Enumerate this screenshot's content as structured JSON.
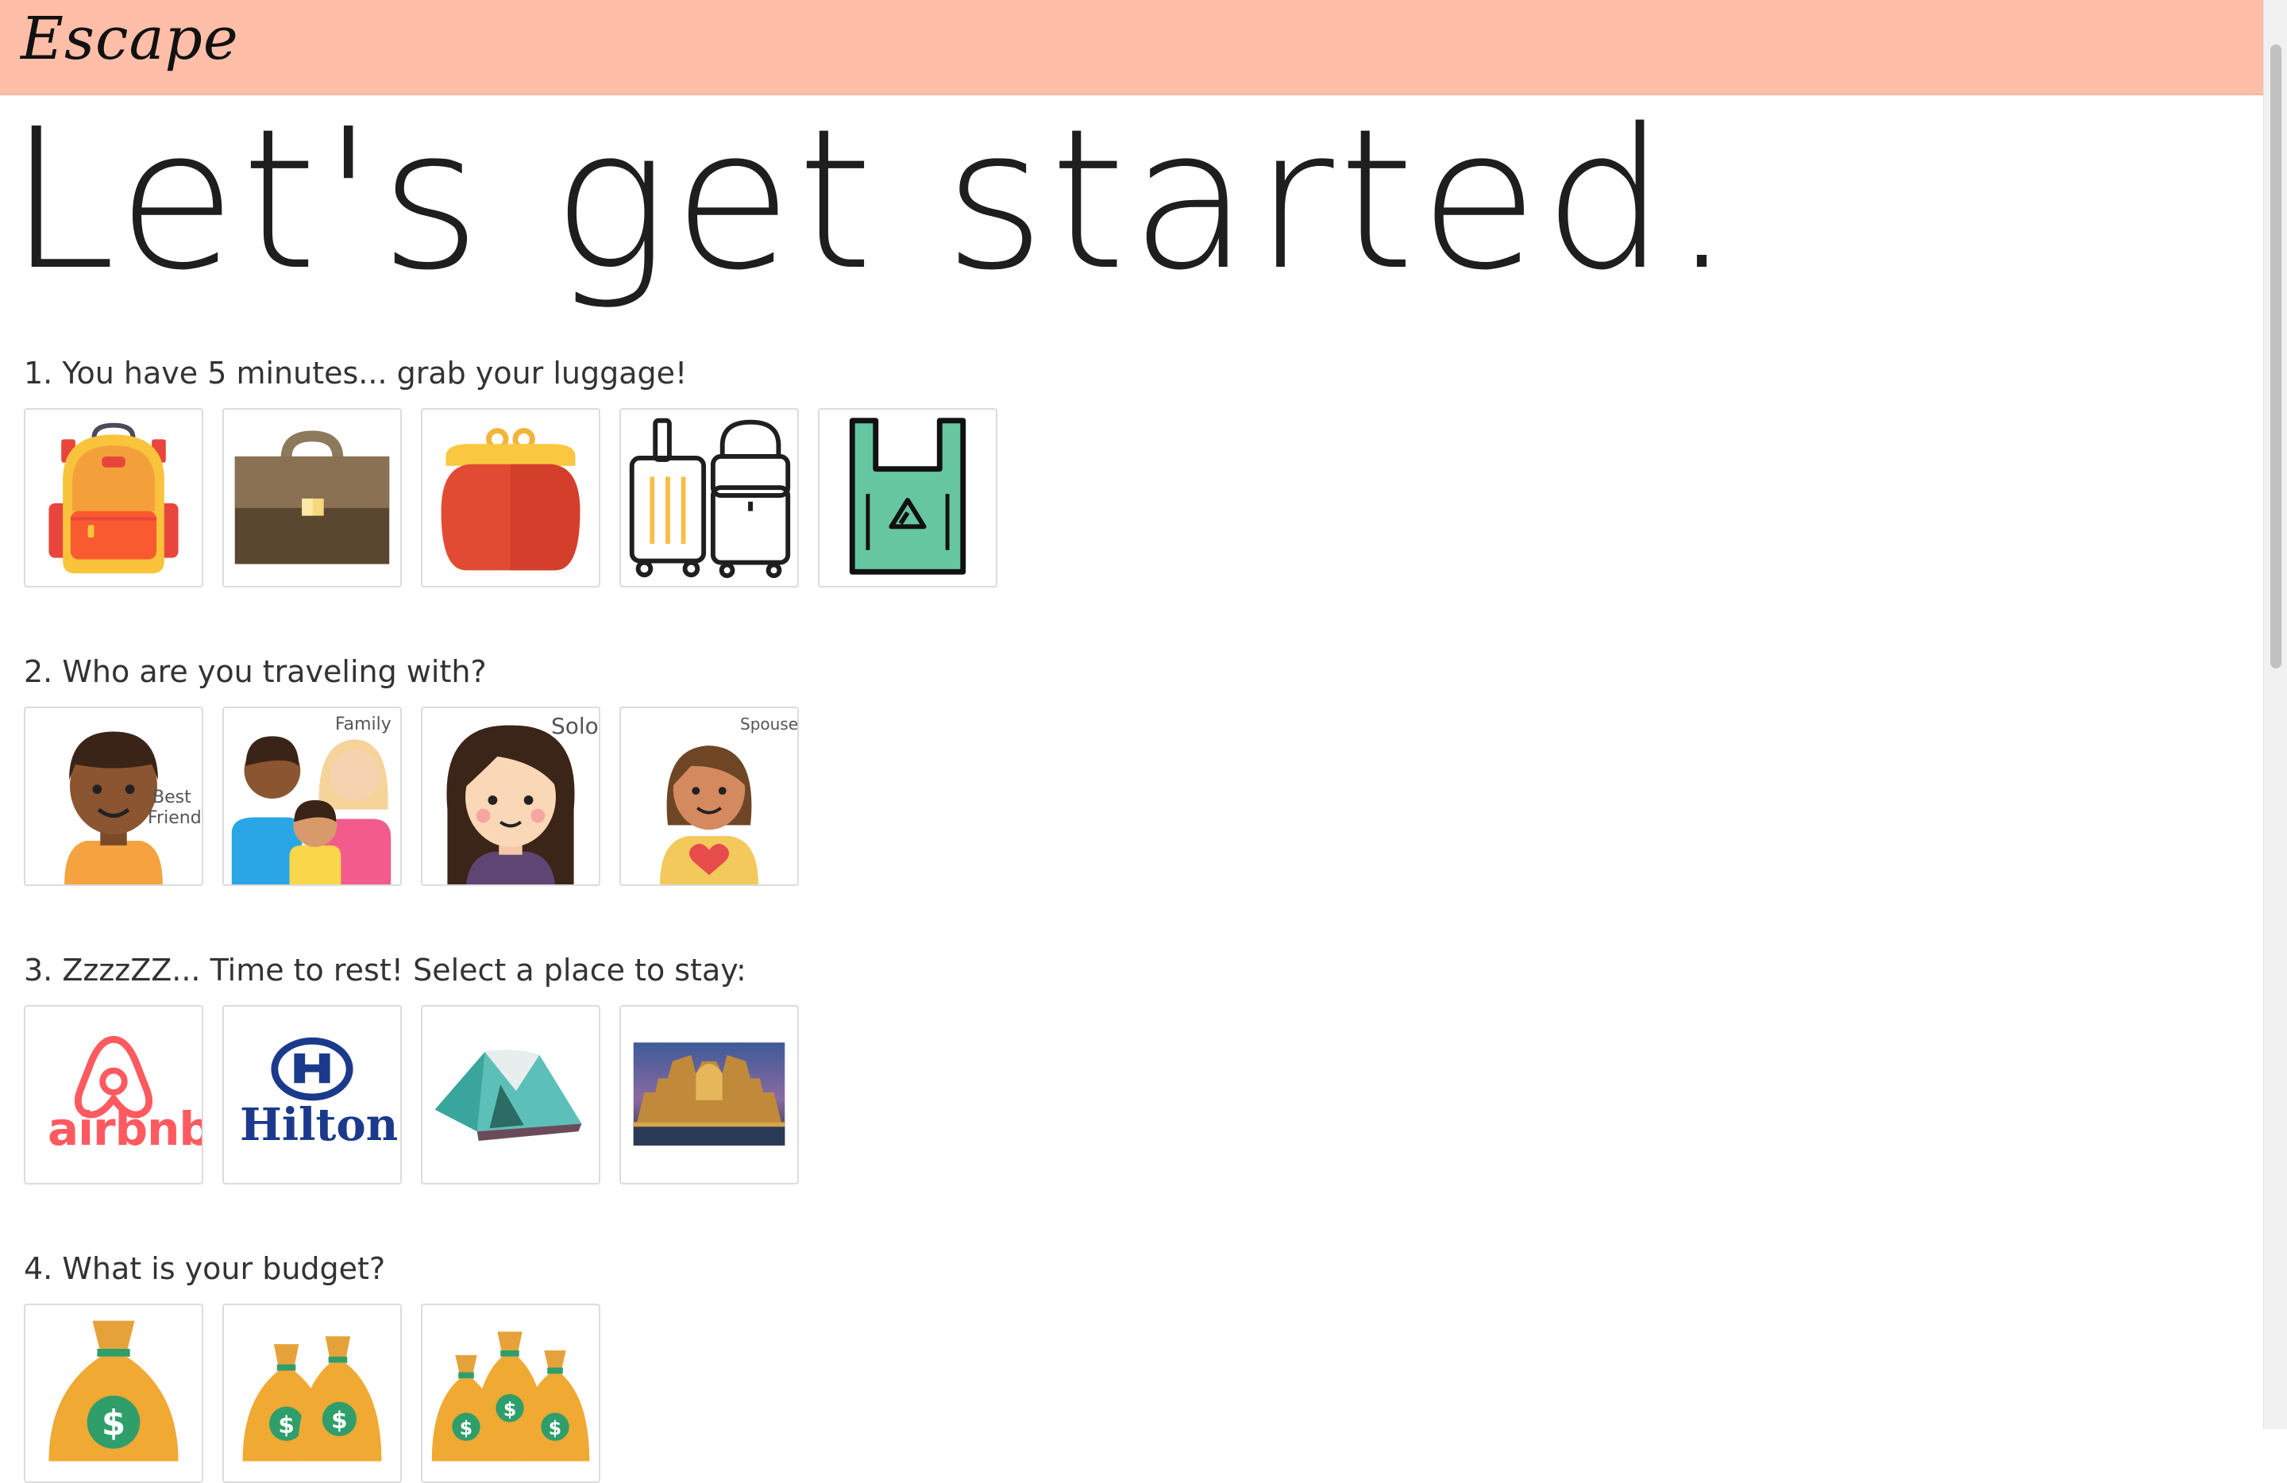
{
  "header": {
    "brand": "Escape"
  },
  "hero": {
    "title": "Let's get started."
  },
  "questions": [
    {
      "label": "1. You have 5 minutes... grab your luggage!",
      "options": [
        "backpack-icon",
        "briefcase-icon",
        "purse-icon",
        "suitcases-icon",
        "plastic-bag-icon"
      ]
    },
    {
      "label": "2. Who are you traveling with?",
      "options": [
        {
          "icon": "best-friend-icon",
          "tag": "Best Friend",
          "tag_line1": "Best",
          "tag_line2": "Friend"
        },
        {
          "icon": "family-icon",
          "tag": "Family"
        },
        {
          "icon": "solo-icon",
          "tag": "Solo"
        },
        {
          "icon": "spouse-icon",
          "tag": "Spouse"
        }
      ]
    },
    {
      "label": "3. ZzzzZZ... Time to rest! Select a place to stay:",
      "options": [
        {
          "icon": "airbnb-logo",
          "text": "airbnb"
        },
        {
          "icon": "hilton-logo",
          "text": "Hilton"
        },
        {
          "icon": "tent-icon"
        },
        {
          "icon": "luxury-resort-photo"
        }
      ]
    },
    {
      "label": "4. What is your budget?",
      "options": [
        "money-bag-one-icon",
        "money-bags-two-icon",
        "money-bags-three-icon"
      ]
    }
  ],
  "colors": {
    "navbar": "#ffbea8",
    "card_border": "#dcdcdc",
    "airbnb": "#ff5a5f",
    "hilton": "#1b3a8c"
  }
}
